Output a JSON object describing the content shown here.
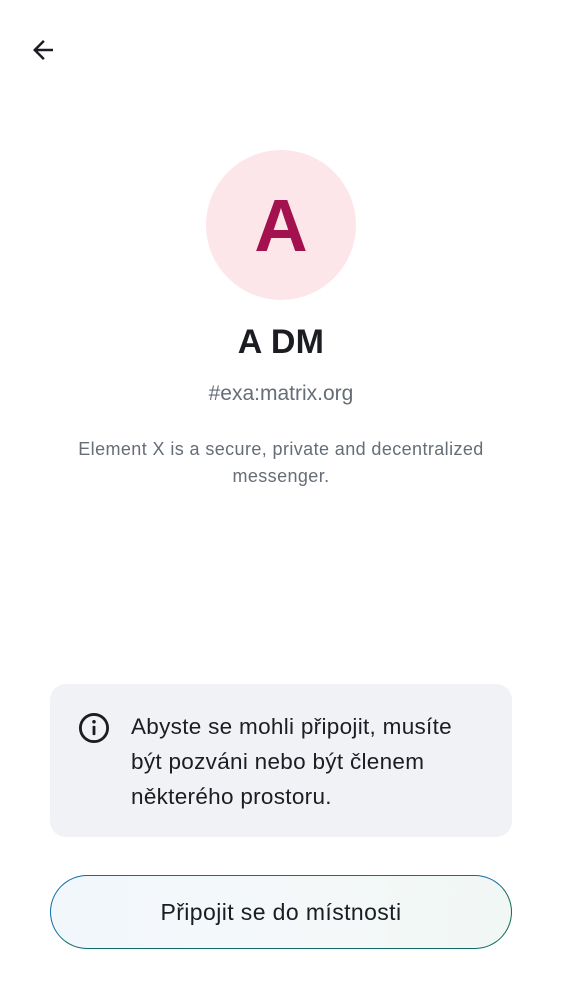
{
  "header": {
    "back_icon": "arrow-left-icon"
  },
  "room": {
    "avatar_letter": "A",
    "avatar_bg_color": "#fde6ea",
    "avatar_fg_color": "#a3114f",
    "name": "A DM",
    "alias": "#exa:matrix.org",
    "description": "Element X is a secure, private and decentralized messenger."
  },
  "notice": {
    "icon": "info-icon",
    "text": "Abyste se mohli připojit, musíte být pozváni nebo být členem některého prostoru."
  },
  "actions": {
    "join_label": "Připojit se do místnosti"
  }
}
